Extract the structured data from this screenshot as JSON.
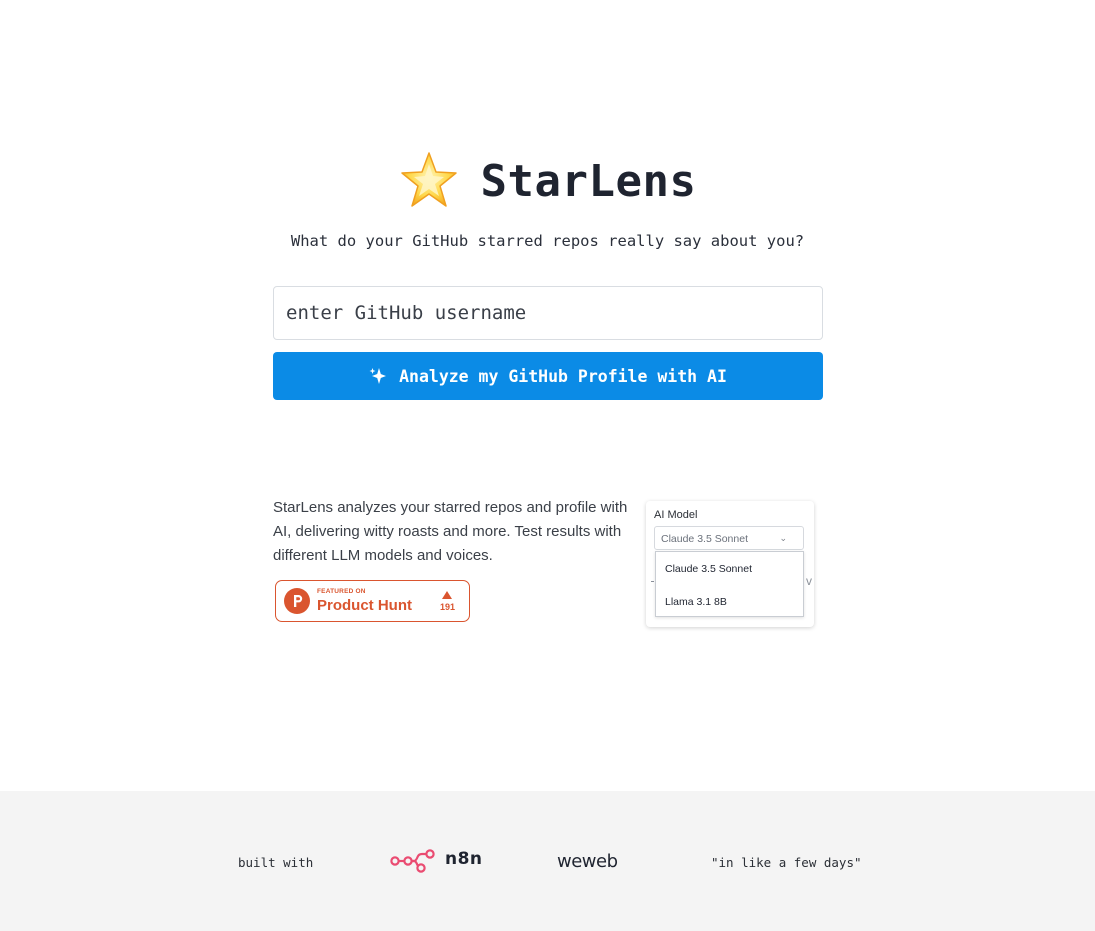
{
  "app": {
    "title": "StarLens",
    "tagline": "What do your GitHub starred repos really say about you?",
    "icons": {
      "title": "glowing-star-icon",
      "button": "sparkle-icon"
    },
    "accent_color": "#0b8be6"
  },
  "search": {
    "value": "",
    "placeholder": "enter GitHub username"
  },
  "analyze_button": {
    "label": "Analyze my GitHub Profile with AI"
  },
  "info": {
    "description": "StarLens analyzes your starred repos and profile with AI, delivering witty roasts and more. Test results with different LLM models and voices."
  },
  "product_hunt": {
    "featured": "FEATURED ON",
    "name": "Product Hunt",
    "votes": "191",
    "color": "#da552f"
  },
  "model_preview": {
    "label": "AI Model",
    "selected": "Claude 3.5 Sonnet",
    "options": [
      "Claude 3.5 Sonnet",
      "Llama 3.1 8B"
    ],
    "partial_text": "v"
  },
  "footer": {
    "built_with": "built with",
    "tools": [
      "n8n",
      "weweb"
    ],
    "quote": "\"in like a few days\"",
    "n8n_color": "#ea4b71"
  }
}
